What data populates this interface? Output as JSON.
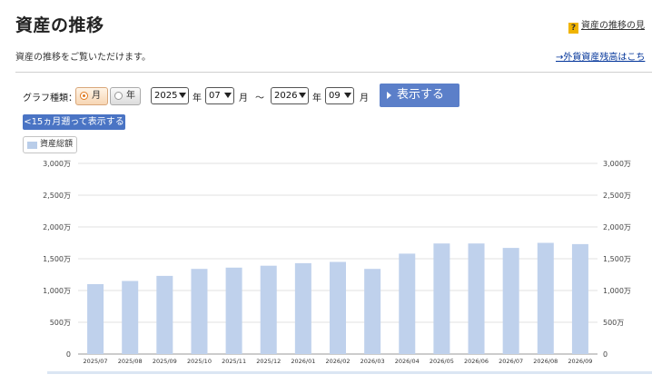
{
  "page": {
    "title": "資産の推移",
    "help_icon": "?",
    "help_link": "資産の推移の見",
    "description": "資産の推移をご覧いただけます。",
    "fx_link": "→外貨資産残高はこち"
  },
  "controls": {
    "graph_type_label": "グラフ種類：",
    "radio_month": "月",
    "radio_year": "年",
    "selected_type": "月",
    "start_year": "2025",
    "start_month": "07",
    "end_year": "2026",
    "end_month": "09",
    "year_unit": "年",
    "month_unit": "月",
    "tilde": "〜",
    "show_button": "表示する",
    "back_button": "<15ヵ月遡って表示する"
  },
  "chart_data": {
    "type": "bar",
    "legend": "資産総額",
    "categories": [
      "2025/07",
      "2025/08",
      "2025/09",
      "2025/10",
      "2025/11",
      "2025/12",
      "2026/01",
      "2026/02",
      "2026/03",
      "2026/04",
      "2026/05",
      "2026/06",
      "2026/07",
      "2026/08",
      "2026/09"
    ],
    "series": [
      {
        "name": "資産総額",
        "values": [
          1100,
          1150,
          1230,
          1340,
          1360,
          1390,
          1430,
          1450,
          1340,
          1580,
          1740,
          1740,
          1670,
          1750,
          1730
        ]
      }
    ],
    "ylim": [
      0,
      3000
    ],
    "yticks": [
      0,
      500,
      1000,
      1500,
      2000,
      2500,
      3000
    ],
    "ytick_labels": [
      "0",
      "500万",
      "1,000万",
      "1,500万",
      "2,000万",
      "2,500万",
      "3,000万"
    ],
    "grid": true,
    "bar_color": "#bfd1ec"
  }
}
